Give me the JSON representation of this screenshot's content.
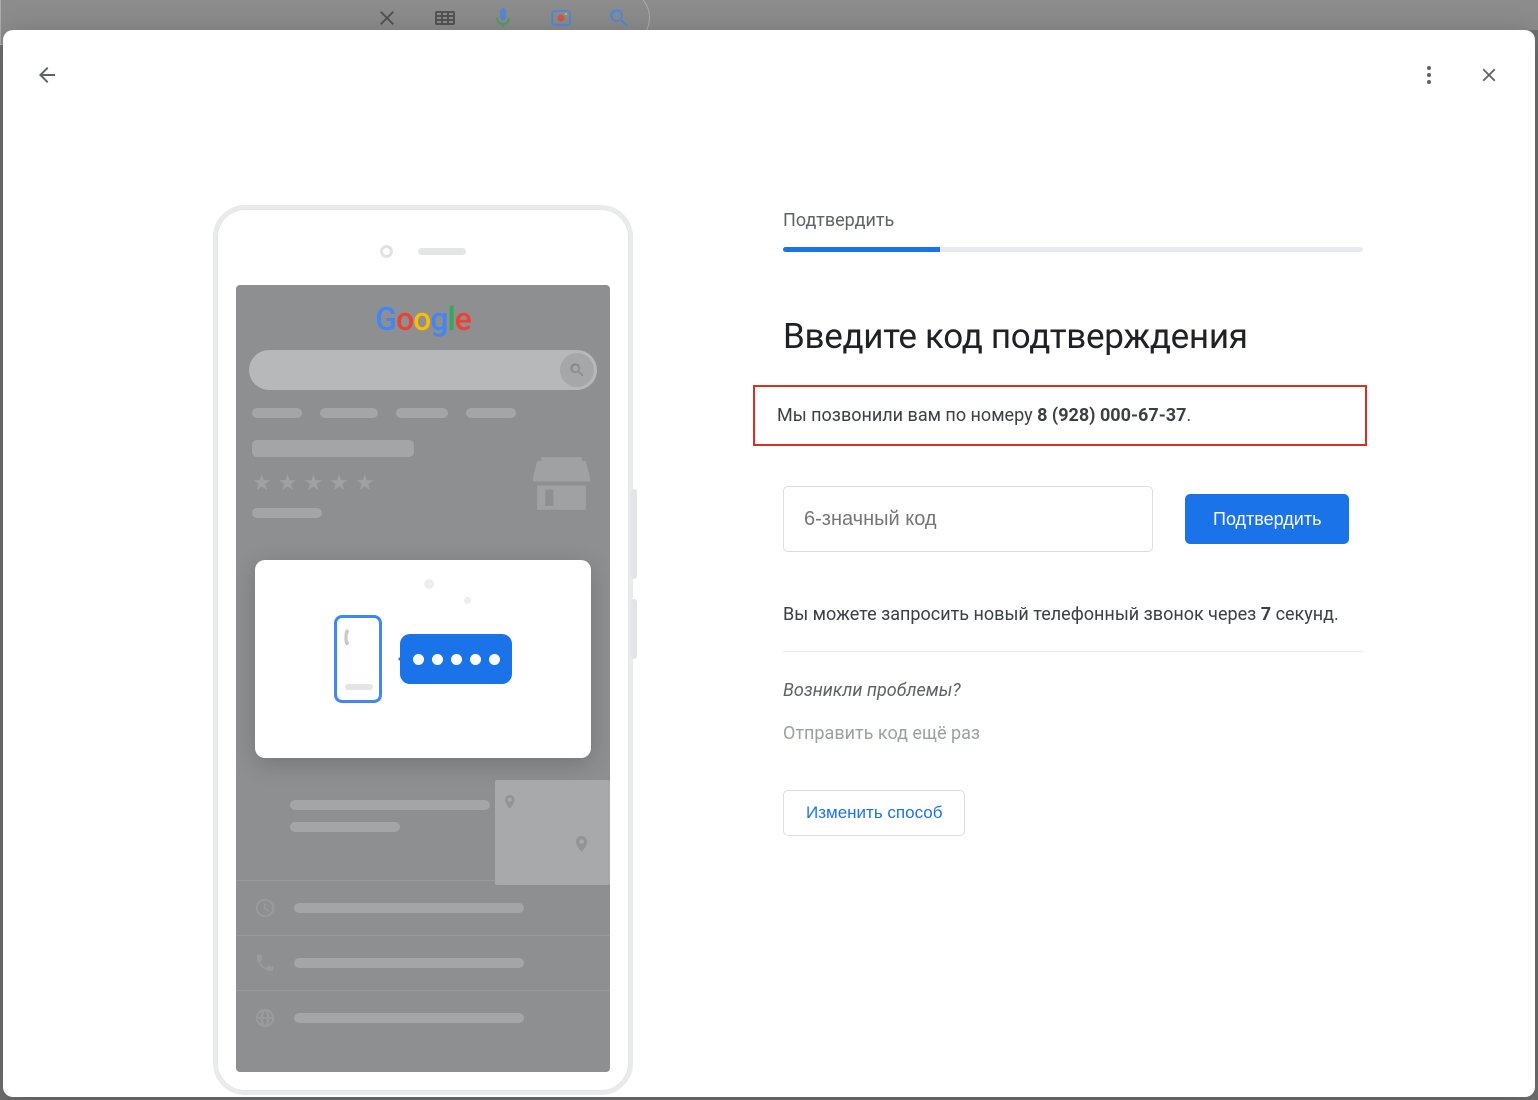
{
  "bg_icons": {
    "clear": "clear-icon",
    "keyboard": "keyboard-icon",
    "mic": "mic-icon",
    "lens": "lens-icon",
    "search": "search-icon"
  },
  "dialog": {
    "step_label": "Подтвердить",
    "progress_percent": 27,
    "title": "Введите код подтверждения",
    "call_prefix": "Мы позвонили вам по номеру ",
    "call_number": "8 (928) 000-67-37",
    "call_suffix": ".",
    "input_placeholder": "6-значный код",
    "confirm_button": "Подтвердить",
    "resend_prefix": "Вы можете запросить новый телефонный звонок через ",
    "resend_seconds": "7",
    "resend_suffix": " секунд.",
    "problems_text": "Возникли проблемы?",
    "send_again": "Отправить код ещё раз",
    "change_method": "Изменить способ"
  },
  "phone_mock": {
    "logo_letters": [
      "G",
      "o",
      "o",
      "g",
      "l",
      "e"
    ]
  },
  "colors": {
    "primary": "#1a73e8",
    "danger": "#d93025",
    "text": "#202124"
  }
}
